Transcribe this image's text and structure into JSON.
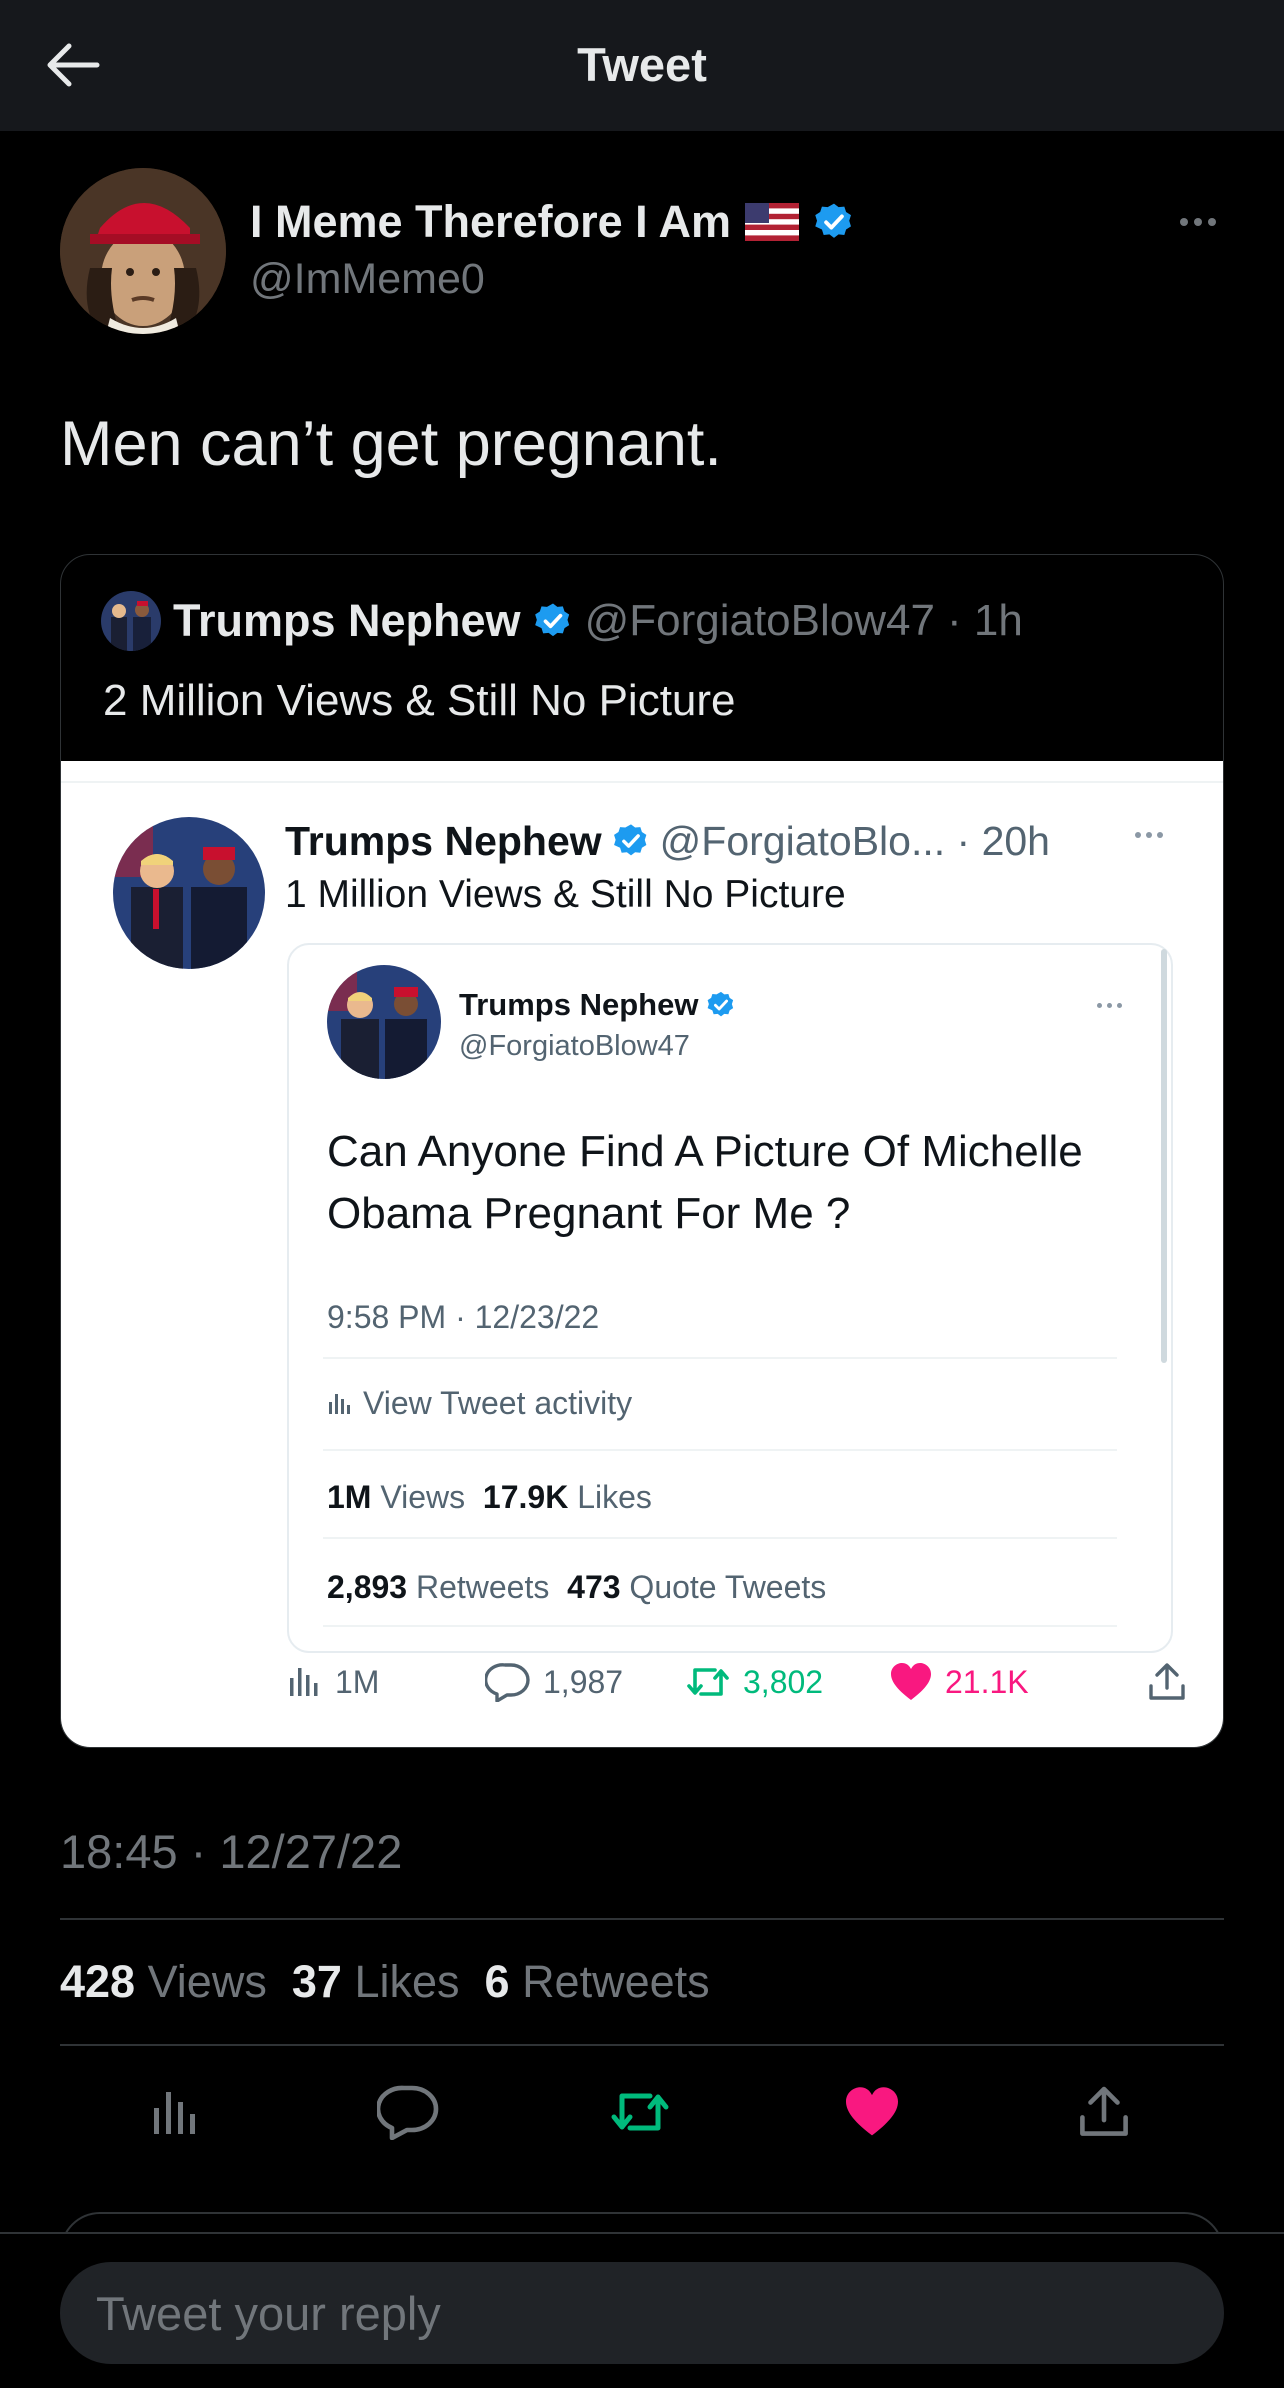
{
  "header": {
    "title": "Tweet",
    "back_icon": "arrow-left-icon"
  },
  "tweet": {
    "author_name": "I Meme Therefore I Am",
    "author_flag": "🇺🇸",
    "author_handle": "@ImMeme0",
    "text": "Men can’t get pregnant.",
    "timestamp": "18:45 · 12/27/22",
    "stats": {
      "views_count": "428",
      "views_label": "Views",
      "likes_count": "37",
      "likes_label": "Likes",
      "retweets_count": "6",
      "retweets_label": "Retweets"
    }
  },
  "quote": {
    "name": "Trumps Nephew",
    "handle": "@ForgiatoBlow47",
    "time": "· 1h",
    "text": "2 Million Views & Still No Picture",
    "screenshot": {
      "name": "Trumps Nephew",
      "handle": "@ForgiatoBlo... · 20h",
      "text": "1 Million Views & Still No Picture",
      "inner": {
        "name": "Trumps Nephew",
        "handle": "@ForgiatoBlow47",
        "text_line1": "Can Anyone Find A Picture Of Michelle",
        "text_line2": "Obama Pregnant For Me ?",
        "time": "9:58 PM · 12/23/22",
        "activity_label": "View Tweet activity",
        "views_count": "1M",
        "views_label": "Views",
        "likes_count": "17.9K",
        "likes_label": "Likes",
        "retweets_count": "2,893",
        "retweets_label": "Retweets",
        "quotes_count": "473",
        "quotes_label": "Quote Tweets"
      },
      "actions": {
        "views": "1M",
        "replies": "1,987",
        "retweets": "3,802",
        "likes": "21.1K"
      }
    }
  },
  "reply": {
    "placeholder": "Tweet your reply"
  },
  "colors": {
    "background": "#000000",
    "text": "#e7e9ea",
    "muted": "#71767b",
    "verified": "#1d9bf0",
    "retweet_green": "#00ba7c",
    "like_pink": "#f91880"
  }
}
